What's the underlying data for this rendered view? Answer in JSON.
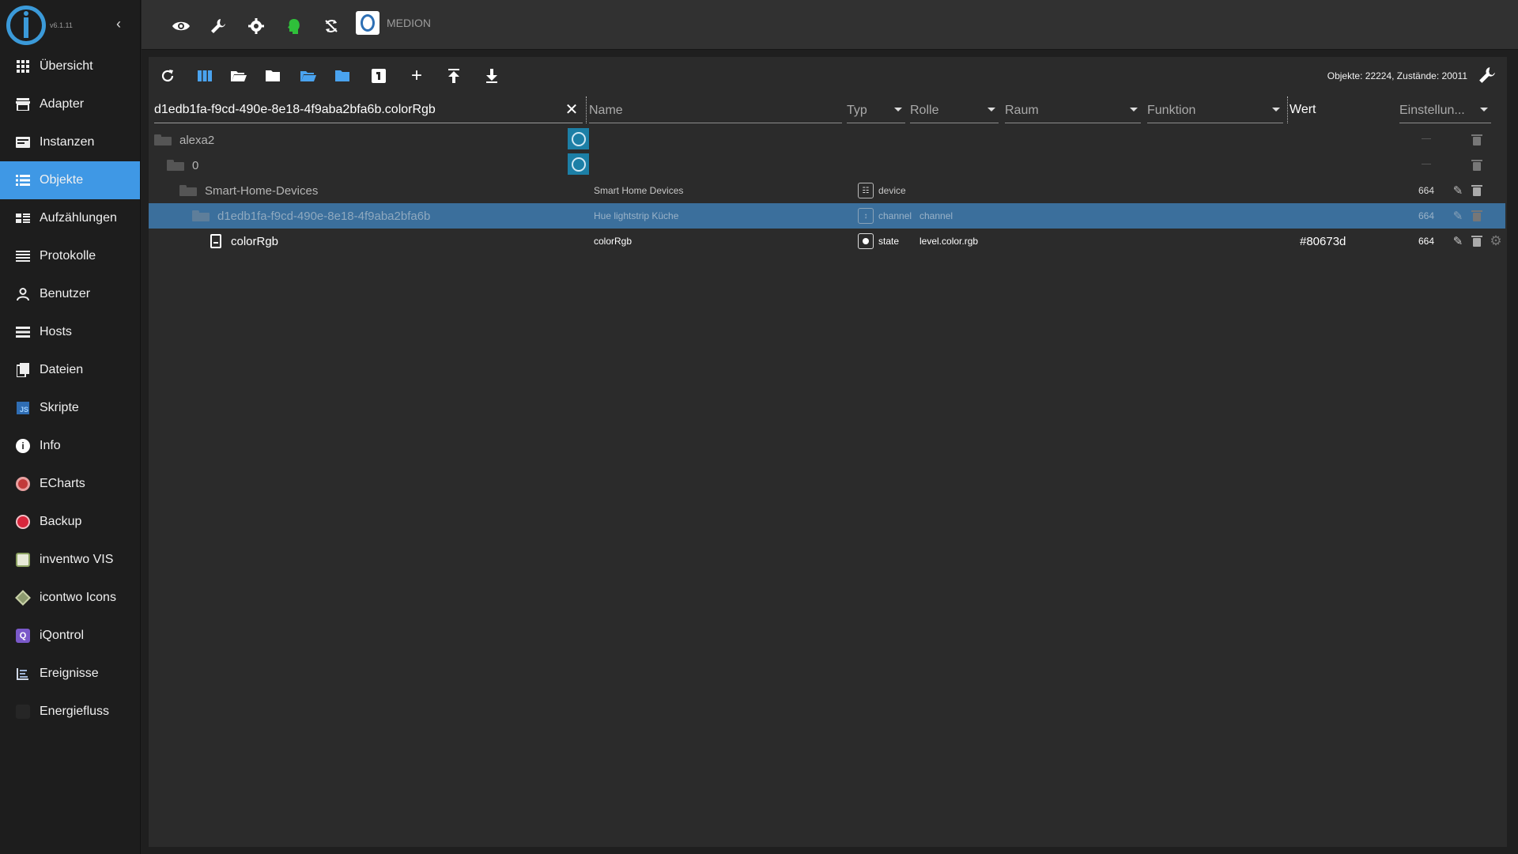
{
  "app": {
    "version": "v6.1.11",
    "host_name": "MEDION"
  },
  "sidebar": {
    "items": [
      {
        "label": "Übersicht",
        "icon": "grid-icon",
        "active": false
      },
      {
        "label": "Adapter",
        "icon": "store-icon",
        "active": false
      },
      {
        "label": "Instanzen",
        "icon": "instances-icon",
        "active": false
      },
      {
        "label": "Objekte",
        "icon": "list-icon",
        "active": true
      },
      {
        "label": "Aufzählungen",
        "icon": "enum-icon",
        "active": false
      },
      {
        "label": "Protokolle",
        "icon": "log-icon",
        "active": false
      },
      {
        "label": "Benutzer",
        "icon": "user-icon",
        "active": false
      },
      {
        "label": "Hosts",
        "icon": "hosts-icon",
        "active": false
      },
      {
        "label": "Dateien",
        "icon": "files-icon",
        "active": false
      },
      {
        "label": "Skripte",
        "icon": "js-icon",
        "active": false
      },
      {
        "label": "Info",
        "icon": "info-icon",
        "active": false
      },
      {
        "label": "ECharts",
        "icon": "echarts-icon",
        "active": false
      },
      {
        "label": "Backup",
        "icon": "backup-icon",
        "active": false
      },
      {
        "label": "inventwo VIS",
        "icon": "inventwo-icon",
        "active": false
      },
      {
        "label": "icontwo Icons",
        "icon": "icontwo-icon",
        "active": false
      },
      {
        "label": "iQontrol",
        "icon": "iqontrol-icon",
        "active": false
      },
      {
        "label": "Ereignisse",
        "icon": "events-icon",
        "active": false
      },
      {
        "label": "Energiefluss",
        "icon": "energy-icon",
        "active": false
      }
    ]
  },
  "stats_label": "Objekte: 22224, Zustände: 20011",
  "filters": {
    "id_value": "d1edb1fa-f9cd-490e-8e18-4f9aba2bfa6b.colorRgb",
    "name_placeholder": "Name",
    "type_label": "Typ",
    "role_label": "Rolle",
    "room_label": "Raum",
    "function_label": "Funktion",
    "value_label": "Wert",
    "settings_label": "Einstellun..."
  },
  "rows": [
    {
      "id": "alexa2",
      "name": "",
      "type": "",
      "role": "",
      "value": "",
      "acl": ""
    },
    {
      "id": "0",
      "name": "",
      "type": "",
      "role": "",
      "value": "",
      "acl": ""
    },
    {
      "id": "Smart-Home-Devices",
      "name": "Smart Home Devices",
      "type": "device",
      "role": "",
      "value": "",
      "acl": "664"
    },
    {
      "id": "d1edb1fa-f9cd-490e-8e18-4f9aba2bfa6b",
      "name": "Hue lightstrip Küche",
      "type": "channel",
      "role": "channel",
      "value": "",
      "acl": "664"
    },
    {
      "id": "colorRgb",
      "name": "colorRgb",
      "type": "state",
      "role": "level.color.rgb",
      "value": "#80673d",
      "acl": "664"
    }
  ],
  "colors": {
    "accent": "#3f98e5",
    "selected_row": "#3b6f9c",
    "alexa_tile": "#1c7fa6",
    "status_green": "#2fbf3a"
  }
}
